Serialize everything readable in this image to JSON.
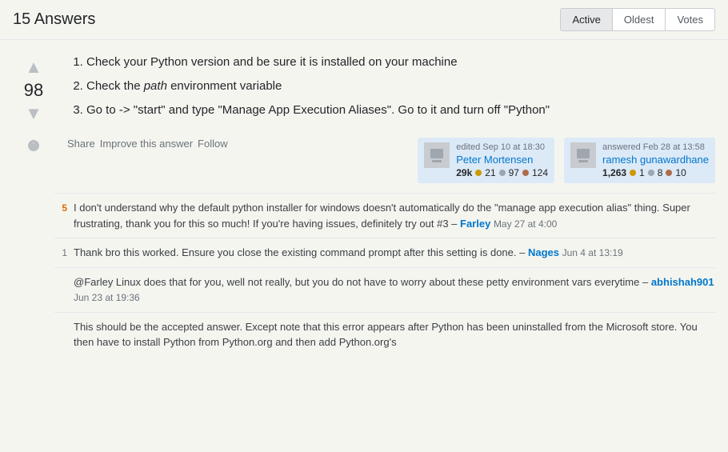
{
  "header": {
    "title": "15 Answers",
    "sort_tabs": [
      {
        "label": "Active",
        "active": true
      },
      {
        "label": "Oldest",
        "active": false
      },
      {
        "label": "Votes",
        "active": false
      }
    ]
  },
  "answer": {
    "vote_count": "98",
    "vote_up_label": "▲",
    "vote_down_label": "▼",
    "body_items": [
      "1. Check your Python version and be sure it is installed on your machine",
      "2. Check the path environment variable",
      "3. Go to -> \"start\" and type \"Manage App Execution Aliases\". Go to it and turn off \"Python\""
    ],
    "path_italic": "path",
    "action_links": [
      "Share",
      "Improve this answer",
      "Follow"
    ],
    "editor": {
      "action": "edited Sep 10 at 18:30",
      "name": "Peter Mortensen",
      "rep": "29k",
      "badges": [
        {
          "color": "gold",
          "count": "21"
        },
        {
          "color": "silver",
          "count": "97"
        },
        {
          "color": "bronze",
          "count": "124"
        }
      ]
    },
    "answerer": {
      "action": "answered Feb 28 at 13:58",
      "name": "ramesh gunawardhane",
      "rep": "1,263",
      "badges": [
        {
          "color": "gold",
          "count": "1"
        },
        {
          "color": "silver",
          "count": "8"
        },
        {
          "color": "bronze",
          "count": "10"
        }
      ]
    }
  },
  "comments": [
    {
      "vote": "5",
      "has_votes": true,
      "text": "I don't understand why the default python installer for windows doesn't automatically do the \"manage app execution alias\" thing. Super frustrating, thank you for this so much! If you're having issues, definitely try out #3 –",
      "user": "Farley",
      "time": "May 27 at 4:00"
    },
    {
      "vote": "1",
      "has_votes": false,
      "text": "Thank bro this worked. Ensure you close the existing command prompt after this setting is done. –",
      "user": "Nages",
      "time": "Jun 4 at 13:19"
    },
    {
      "vote": "",
      "has_votes": false,
      "text": "@Farley Linux does that for you, well not really, but you do not have to worry about these petty environment vars everytime –",
      "user": "abhishah901",
      "time": "Jun 23 at 19:36"
    },
    {
      "vote": "",
      "has_votes": false,
      "text": "This should be the accepted answer. Except note that this error appears after Python has been uninstalled from the Microsoft store. You then have to install Python from Python.org and then add Python.org's",
      "user": "",
      "time": ""
    }
  ]
}
